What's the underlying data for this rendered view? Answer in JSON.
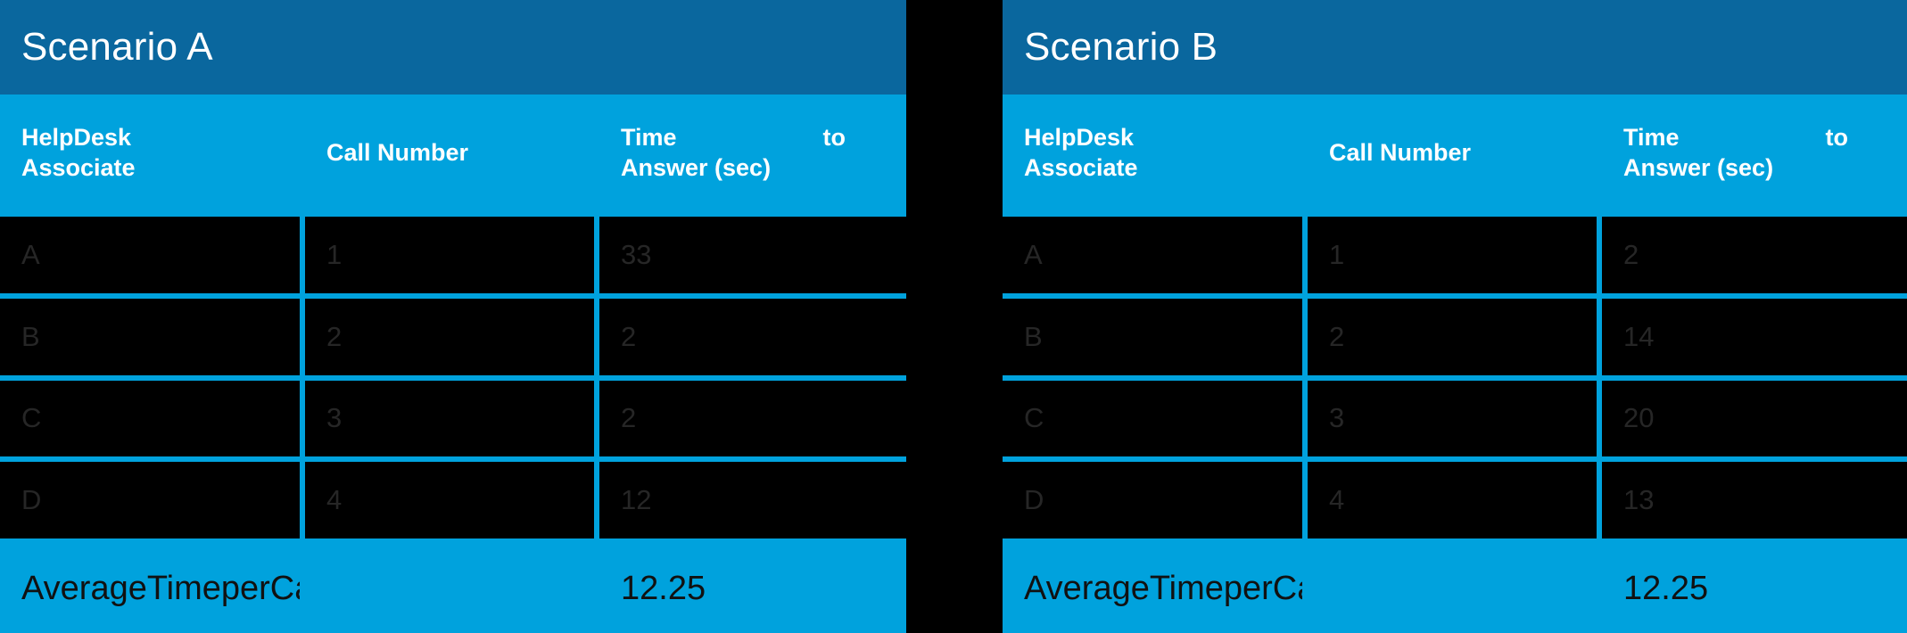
{
  "background_color": "#000000",
  "theme": {
    "title_bar_color": "#0a679e",
    "accent_color": "#00a2dd",
    "cell_background": "#000000",
    "cell_text_color": "#262626",
    "header_text_color": "#ffffff",
    "footer_text_color": "#111111"
  },
  "tables": [
    {
      "title": "Scenario A",
      "columns": [
        {
          "line1": "HelpDesk",
          "line2": "Associate"
        },
        {
          "line1": "Call Number",
          "line2": ""
        },
        {
          "line1": "Time",
          "line1b": "to",
          "line2": "Answer (sec)"
        }
      ],
      "rows": [
        {
          "associate": "A",
          "call_number": "1",
          "time_to_answer": "33"
        },
        {
          "associate": "B",
          "call_number": "2",
          "time_to_answer": "2"
        },
        {
          "associate": "C",
          "call_number": "3",
          "time_to_answer": "2"
        },
        {
          "associate": "D",
          "call_number": "4",
          "time_to_answer": "12"
        }
      ],
      "footer": {
        "label": "AverageTimeperCall",
        "middle": "",
        "value": "12.25"
      }
    },
    {
      "title": "Scenario B",
      "columns": [
        {
          "line1": "HelpDesk",
          "line2": "Associate"
        },
        {
          "line1": "Call Number",
          "line2": ""
        },
        {
          "line1": "Time",
          "line1b": "to",
          "line2": "Answer (sec)"
        }
      ],
      "rows": [
        {
          "associate": "A",
          "call_number": "1",
          "time_to_answer": "2"
        },
        {
          "associate": "B",
          "call_number": "2",
          "time_to_answer": "14"
        },
        {
          "associate": "C",
          "call_number": "3",
          "time_to_answer": "20"
        },
        {
          "associate": "D",
          "call_number": "4",
          "time_to_answer": "13"
        }
      ],
      "footer": {
        "label": "AverageTimeperCall",
        "middle": "",
        "value": "12.25"
      }
    }
  ]
}
